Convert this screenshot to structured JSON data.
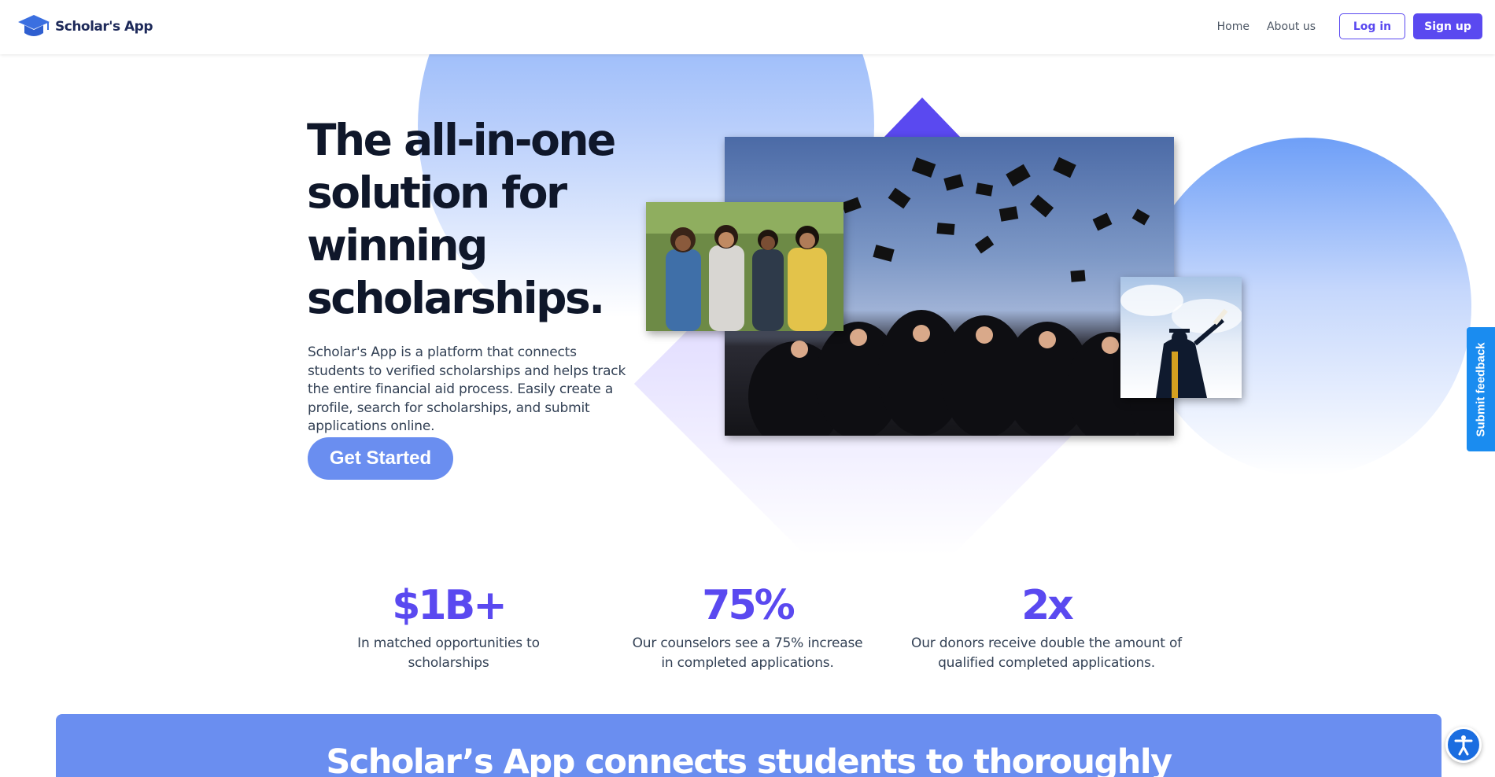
{
  "brand": {
    "name": "Scholar's App",
    "accent": "#5a49f0",
    "secondary": "#6a8ef0",
    "feedback_color": "#1a8cf0"
  },
  "nav": {
    "links": [
      "Home",
      "About us"
    ],
    "login_label": "Log in",
    "signup_label": "Sign up"
  },
  "hero": {
    "title": "The all-in-one solution for winning scholarships.",
    "description": "Scholar's App is a platform that connects students to verified scholarships and helps track the entire financial aid process. Easily create a profile, search for scholarships, and submit applications online.",
    "cta_label": "Get Started"
  },
  "feedback": {
    "label": "Submit feedback"
  },
  "stats": [
    {
      "value": "$1B+",
      "description": "In matched opportunities to scholarships"
    },
    {
      "value": "75%",
      "description": "Our counselors see a 75% increase in completed applications."
    },
    {
      "value": "2x",
      "description": "Our donors receive double the amount of qualified completed applications."
    }
  ],
  "banner": {
    "title": "Scholar’s App connects students to thoroughly"
  },
  "icons": {
    "logo": "graduation-cap-icon",
    "accessibility": "accessibility-icon"
  }
}
